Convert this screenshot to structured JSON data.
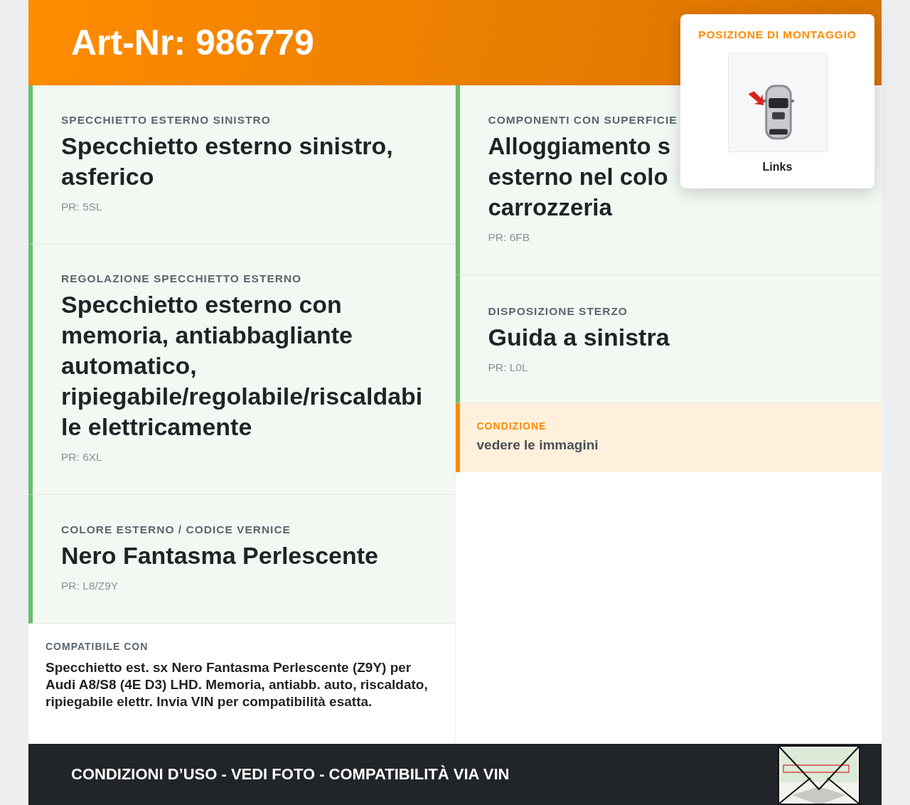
{
  "header": {
    "title": "Art-Nr: 986779"
  },
  "mount_position": {
    "title": "POSIZIONE DI MONTAGGIO",
    "caption": "Links"
  },
  "columns": [
    {
      "cards": [
        {
          "kind": "spec",
          "label": "SPECCHIETTO ESTERNO SINISTRO",
          "title": "Specchietto esterno sinistro, asferico",
          "code": "PR: 5SL"
        },
        {
          "kind": "spec",
          "label": "REGOLAZIONE SPECCHIETTO ESTERNO",
          "title": "Specchietto esterno con memoria, antiabbagliante automatico, ripiegabile/regolabile/riscaldabile elettricamente",
          "code": "PR: 6XL"
        },
        {
          "kind": "spec",
          "label": "COLORE ESTERNO / CODICE VERNICE",
          "title": "Nero Fantasma Perlescente",
          "code": "PR: L8/Z9Y"
        },
        {
          "kind": "compat",
          "label": "COMPATIBILE CON",
          "text": "Specchietto est. sx Nero Fantasma Perlescente (Z9Y) per Audi A8/S8 (4E D3) LHD. Memoria, antiabb. auto, riscaldato, ripiegabile elettr. Invia VIN per compatibilità esatta."
        }
      ]
    },
    {
      "cards": [
        {
          "kind": "spec",
          "label": "COMPONENTI CON SUPERFICIE",
          "title_lines": [
            "Alloggiamento s",
            "esterno nel colo",
            "carrozzeria"
          ],
          "code": "PR: 6FB"
        },
        {
          "kind": "spec",
          "label": "DISPOSIZIONE STERZO",
          "title": "Guida a sinistra",
          "code": "PR: L0L"
        },
        {
          "kind": "note",
          "label": "CONDIZIONE",
          "text": "vedere le immagini"
        }
      ]
    }
  ],
  "footer": {
    "text": "CONDIZIONI D’USO - VEDI FOTO - COMPATIBILITÀ VIA VIN"
  }
}
